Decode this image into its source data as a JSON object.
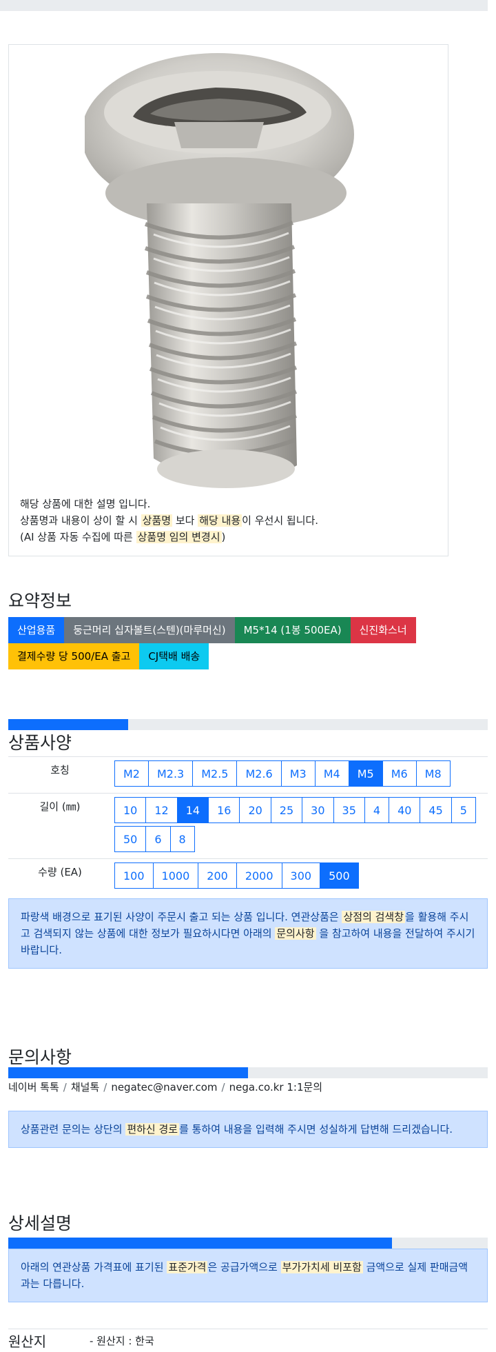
{
  "product": {
    "desc_line1": "해당 상품에 대한 설명 입니다.",
    "desc_line2_a": "상품명과 내용이 상이 할 시 ",
    "desc_line2_hl1": "상품명",
    "desc_line2_b": " 보다 ",
    "desc_line2_hl2": "해당 내용",
    "desc_line2_c": "이 우선시 됩니다.",
    "desc_line3_a": "(AI 상품 자동 수집에 따른 ",
    "desc_line3_hl": "상품명 임의 변경시",
    "desc_line3_b": ")"
  },
  "summary": {
    "title": "요약정보",
    "badges": [
      "산업용품",
      "둥근머리 십자볼트(스텐)(마루머신)",
      "M5*14 (1봉 500EA)",
      "신진화스너",
      "결제수량 당 500/EA 출고",
      "CJ택배 배송"
    ]
  },
  "spec": {
    "title": "상품사양",
    "progress_fraction": 0.25,
    "rows": [
      {
        "label": "호칭",
        "options": [
          "M2",
          "M2.3",
          "M2.5",
          "M2.6",
          "M3",
          "M4",
          "M5",
          "M6",
          "M8"
        ],
        "selected": "M5"
      },
      {
        "label": "길이 (㎜)",
        "options": [
          "10",
          "12",
          "14",
          "16",
          "20",
          "25",
          "30",
          "35",
          "4",
          "40",
          "45",
          "5",
          "50",
          "6",
          "8"
        ],
        "selected": "14"
      },
      {
        "label": "수량 (EA)",
        "options": [
          "100",
          "1000",
          "200",
          "2000",
          "300",
          "500"
        ],
        "selected": "500"
      }
    ],
    "notice_a": "파랑색 배경으로 표기된 사양이 주문시 출고 되는 상품 입니다. 연관상품은 ",
    "notice_hl1": "상점의 검색창",
    "notice_b": "을 활용해 주시고 검색되지 않는 상품에 대한 정보가 필요하시다면 아래의 ",
    "notice_hl2": "문의사항",
    "notice_c": " 을 참고하여 내용을 전달하여 주시기 바랍니다."
  },
  "inquiry": {
    "title": "문의사항",
    "progress_fraction": 0.5,
    "contacts": [
      "네이버 톡톡",
      "채널톡",
      "negatec@naver.com",
      "nega.co.kr 1:1문의"
    ],
    "notice_a": "상품관련 문의는 상단의 ",
    "notice_hl": "편하신 경로",
    "notice_b": "를 통하여 내용을 입력해 주시면 성실하게 답변해 드리겠습니다."
  },
  "detail": {
    "title": "상세설명",
    "progress_fraction": 0.8,
    "notice_a": "아래의 연관상품 가격표에 표기된 ",
    "notice_hl1": "표준가격",
    "notice_b": "은 공급가액으로 ",
    "notice_hl2": "부가가치세 비포함",
    "notice_c": " 금액으로 실제 판매금액과는 다릅니다."
  },
  "origin": {
    "label": "원산지",
    "value": "- 원산지 : 한국"
  }
}
